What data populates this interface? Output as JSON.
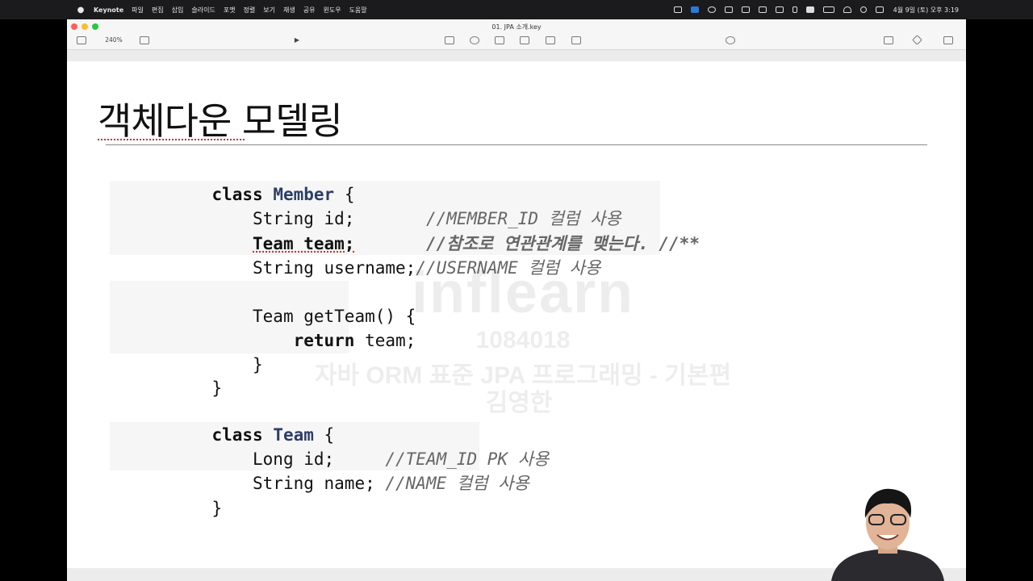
{
  "menubar": {
    "app_name": "Keynote",
    "items": [
      "파일",
      "편집",
      "삽입",
      "슬라이드",
      "포맷",
      "정렬",
      "보기",
      "재생",
      "공유",
      "윈도우",
      "도움말"
    ],
    "clock": "4월 9일 (토) 오후 3:19"
  },
  "window": {
    "document_title": "01. JPA 소개.key",
    "zoom": "240%"
  },
  "slide": {
    "title": "객체다운 모델링",
    "code": {
      "line1_kw": "class",
      "line1_cls": "Member",
      "line1_rest": " {",
      "line2_code": "    String id;       ",
      "line2_comment": "//MEMBER_ID 컬럼 사용",
      "line3_indent": "    ",
      "line3_code": "Team team;",
      "line3_pad": "       ",
      "line3_comment": "//참조로 연관관계를 맺는다. //**",
      "line4_code": "    String username;",
      "line4_comment": "//USERNAME 컬럼 사용",
      "line6_code": "    Team getTeam() {",
      "line7_indent": "        ",
      "line7_kw": "return",
      "line7_rest": " team;",
      "line8": "    }",
      "line9": "}",
      "line11_kw": "class",
      "line11_cls": "Team",
      "line11_rest": " {",
      "line12_code": "    Long id;     ",
      "line12_comment": "//TEAM_ID PK 사용",
      "line13_code": "    String name; ",
      "line13_comment": "//NAME 컬럼 사용",
      "line14": "}"
    }
  },
  "watermark": {
    "logo": "inflearn",
    "id": "1084018",
    "course": "자바 ORM 표준 JPA 프로그래밍 - 기본편",
    "name": "김영한"
  }
}
